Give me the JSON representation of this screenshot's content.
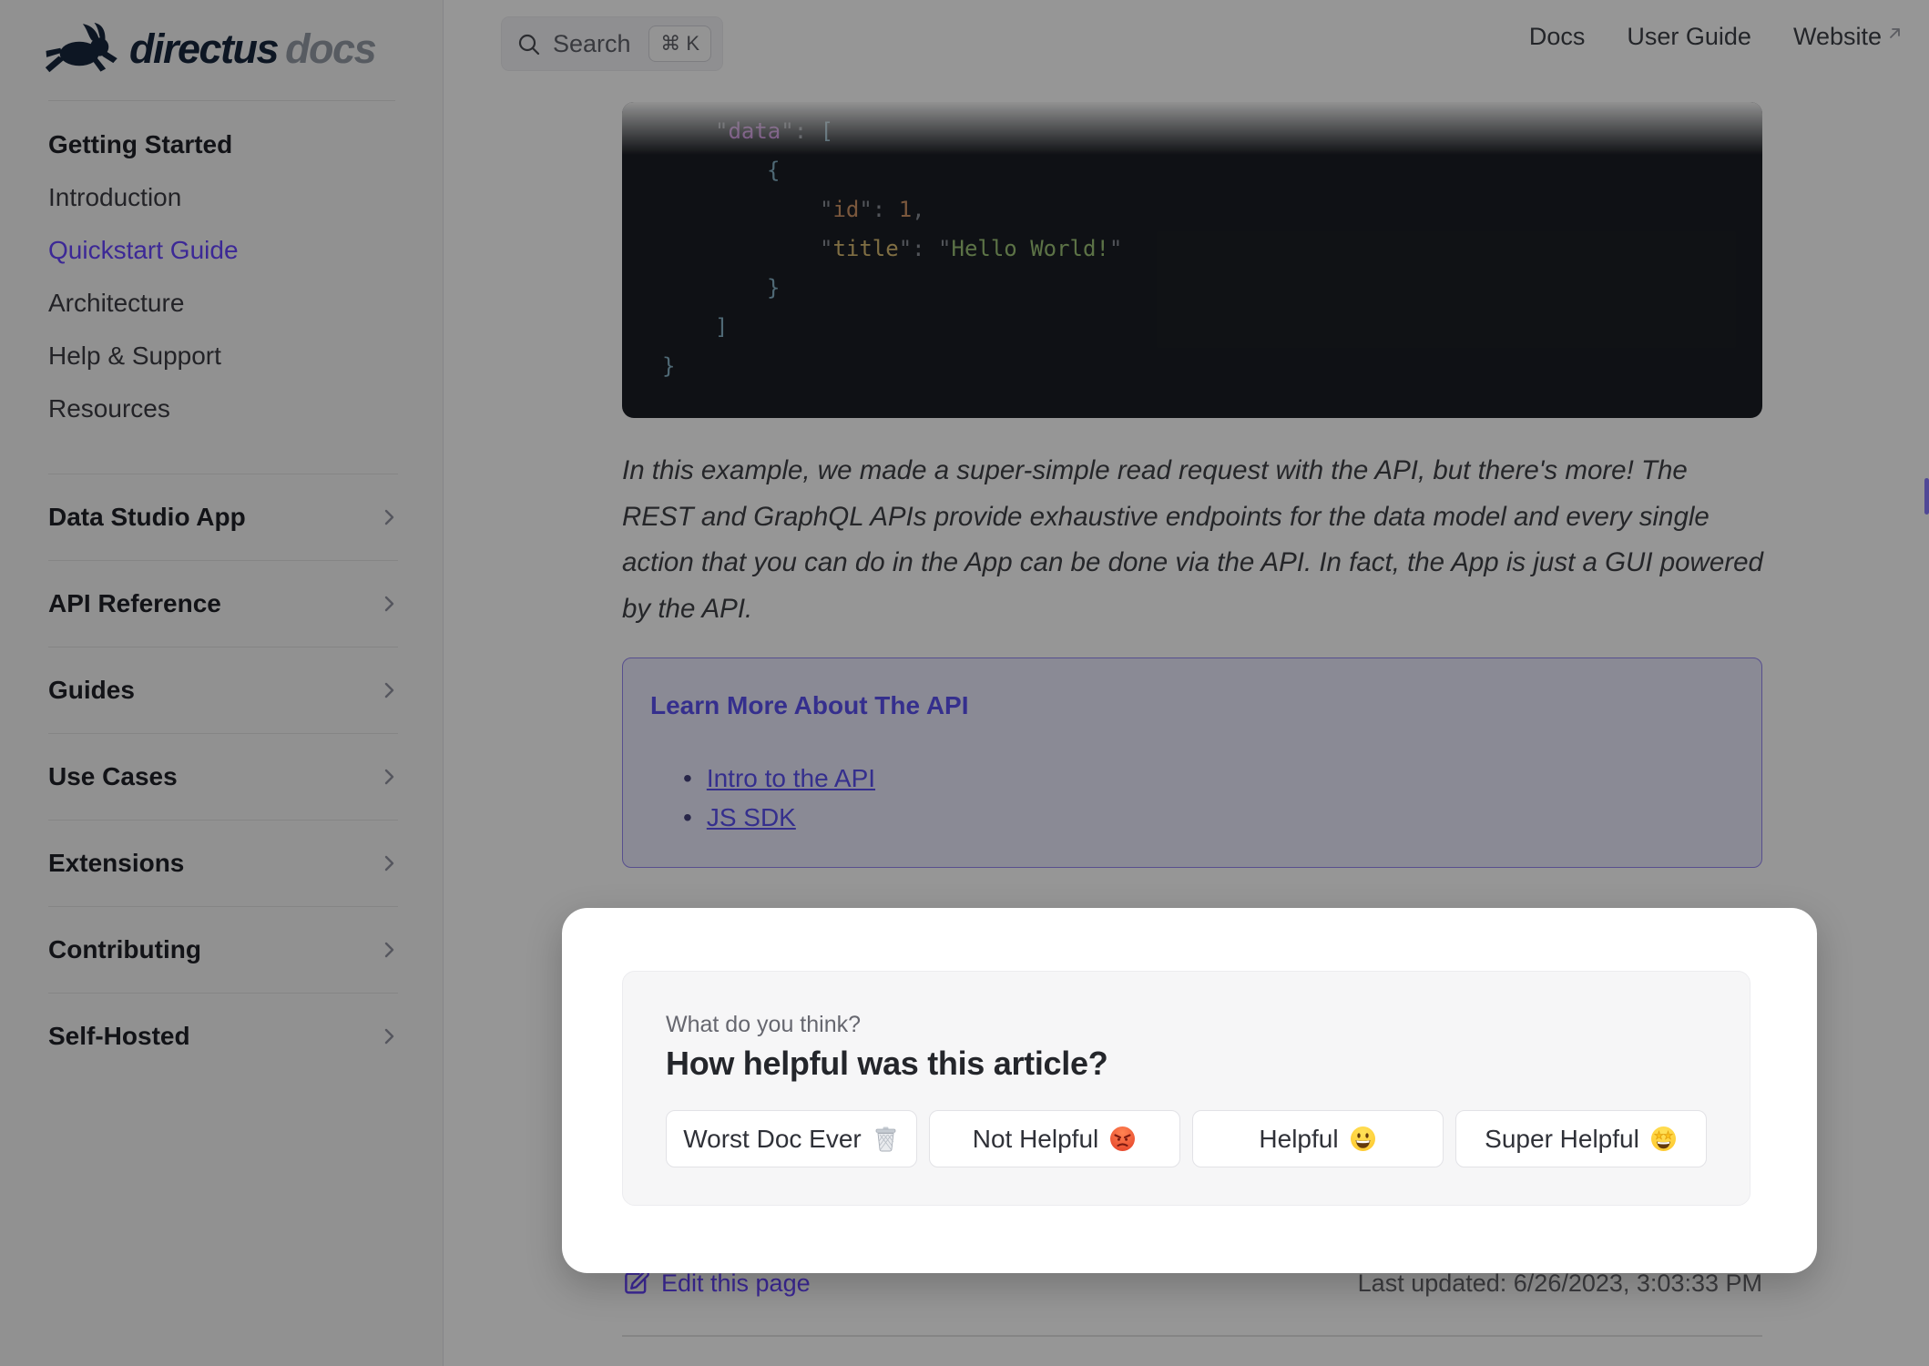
{
  "logo": {
    "brand": "directus",
    "product": "docs"
  },
  "search": {
    "label": "Search",
    "shortcut": "⌘ K"
  },
  "nav": {
    "docs": "Docs",
    "user_guide": "User Guide",
    "website": "Website"
  },
  "sidebar": {
    "group_title": "Getting Started",
    "links": [
      "Introduction",
      "Quickstart Guide",
      "Architecture",
      "Help & Support",
      "Resources"
    ],
    "active_link": "Quickstart Guide",
    "sections": [
      "Data Studio App",
      "API Reference",
      "Guides",
      "Use Cases",
      "Extensions",
      "Contributing",
      "Self-Hosted"
    ]
  },
  "code": {
    "lines": [
      {
        "ind": 1,
        "tokens": [
          {
            "c": "q",
            "t": "\""
          },
          {
            "c": "kp",
            "t": "data"
          },
          {
            "c": "q",
            "t": "\": "
          },
          {
            "c": "br",
            "t": "["
          }
        ]
      },
      {
        "ind": 2,
        "tokens": [
          {
            "c": "br",
            "t": "{"
          }
        ]
      },
      {
        "ind": 3,
        "tokens": [
          {
            "c": "q",
            "t": "\""
          },
          {
            "c": "ko",
            "t": "id"
          },
          {
            "c": "q",
            "t": "\": "
          },
          {
            "c": "num",
            "t": "1"
          },
          {
            "c": "q",
            "t": ","
          }
        ]
      },
      {
        "ind": 3,
        "tokens": [
          {
            "c": "q",
            "t": "\""
          },
          {
            "c": "ky",
            "t": "title"
          },
          {
            "c": "q",
            "t": "\": \""
          },
          {
            "c": "str",
            "t": "Hello World!"
          },
          {
            "c": "q",
            "t": "\""
          }
        ]
      },
      {
        "ind": 2,
        "tokens": [
          {
            "c": "br",
            "t": "}"
          }
        ]
      },
      {
        "ind": 1,
        "tokens": [
          {
            "c": "br",
            "t": "]"
          }
        ]
      },
      {
        "ind": 0,
        "tokens": [
          {
            "c": "br",
            "t": "}"
          }
        ]
      }
    ]
  },
  "article": {
    "paragraph": "In this example, we made a super-simple read request with the API, but there's more! The REST and GraphQL APIs provide exhaustive endpoints for the data model and every single action that you can do in the App can be done via the API. In fact, the App is just a GUI powered by the API."
  },
  "learn_more": {
    "title": "Learn More About The API",
    "links": [
      "Intro to the API",
      "JS SDK"
    ]
  },
  "feedback": {
    "kicker": "What do you think?",
    "question": "How helpful was this article?",
    "options": [
      {
        "label": "Worst Doc Ever",
        "icon": "wastebasket-emoji"
      },
      {
        "label": "Not Helpful",
        "icon": "angry-face-emoji"
      },
      {
        "label": "Helpful",
        "icon": "grinning-face-emoji"
      },
      {
        "label": "Super Helpful",
        "icon": "star-struck-emoji"
      }
    ]
  },
  "footer": {
    "edit_link": "Edit this page",
    "last_updated": "Last updated: 6/26/2023, 3:03:33 PM"
  },
  "colors": {
    "accent": "#6644ff",
    "sidebar_bg": "#f6f6f7",
    "code_bg": "#1b1e24",
    "overlay": "rgba(0,0,0,0.41)"
  }
}
